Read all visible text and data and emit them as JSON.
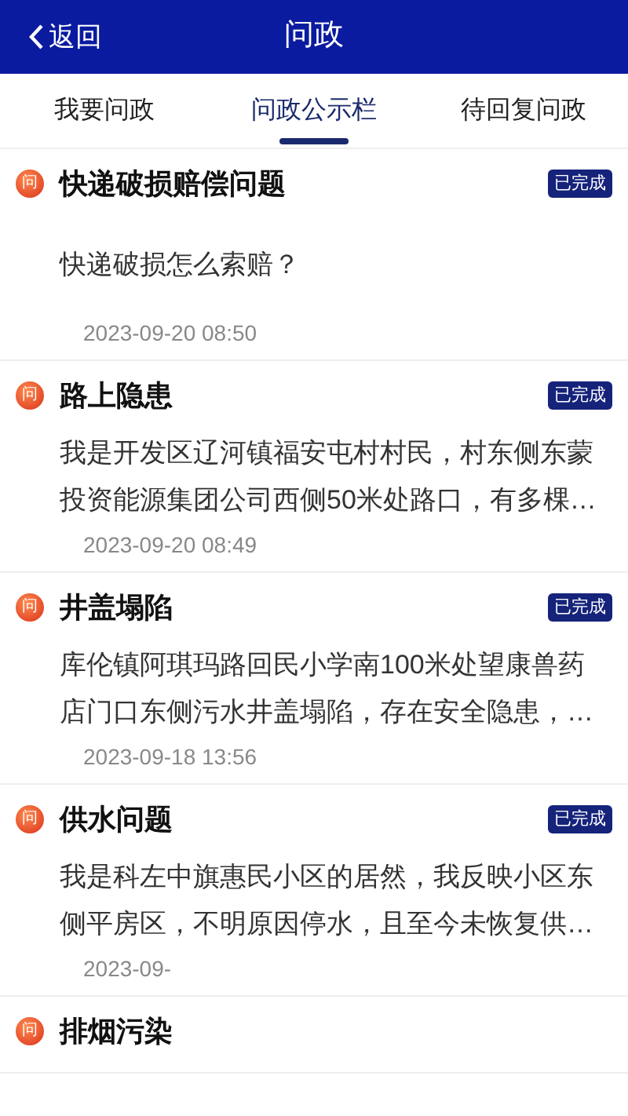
{
  "header": {
    "back_label": "返回",
    "title": "问政"
  },
  "tabs": [
    {
      "label": "我要问政",
      "selected": false
    },
    {
      "label": "问政公示栏",
      "selected": true
    },
    {
      "label": "待回复问政",
      "selected": false
    }
  ],
  "items": [
    {
      "icon_char": "问",
      "title": "快递破损赔偿问题",
      "status": "已完成",
      "body_lines": [
        "快递破损怎么索赔？"
      ],
      "time": "2023-09-20 08:50"
    },
    {
      "icon_char": "问",
      "title": "路上隐患",
      "status": "已完成",
      "body_lines": [
        "我是开发区辽河镇福安屯村村民，村东侧东蒙",
        "投资能源集团公司西侧50米处路口，有多棵…"
      ],
      "time": "2023-09-20 08:49"
    },
    {
      "icon_char": "问",
      "title": "井盖塌陷",
      "status": "已完成",
      "body_lines": [
        "库伦镇阿琪玛路回民小学南100米处望康兽药",
        "店门口东侧污水井盖塌陷，存在安全隐患，…"
      ],
      "time": "2023-09-18 13:56"
    },
    {
      "icon_char": "问",
      "title": "供水问题",
      "status": "已完成",
      "body_lines": [
        "我是科左中旗惠民小区的居然，我反映小区东",
        "侧平房区，不明原因停水，且至今未恢复供…"
      ],
      "time": "2023-09-"
    },
    {
      "icon_char": "问",
      "title": "排烟污染"
    }
  ]
}
